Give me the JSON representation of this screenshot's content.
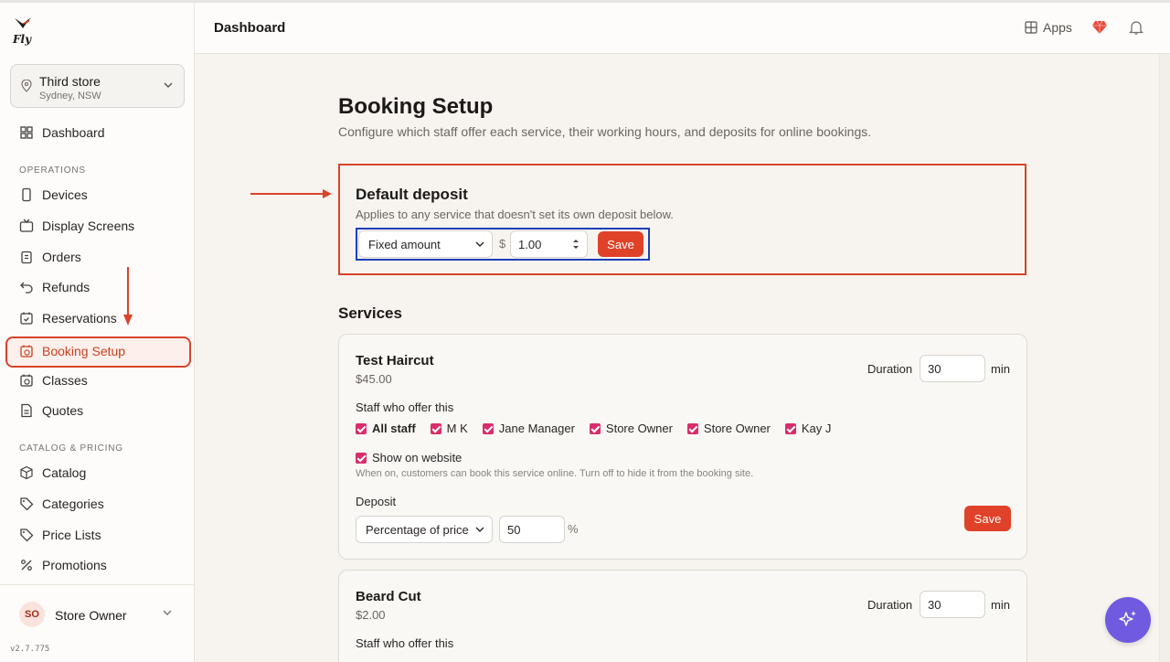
{
  "app": {
    "logo_text": "Fly",
    "version": "v2.7.775"
  },
  "store": {
    "name": "Third store",
    "location": "Sydney, NSW"
  },
  "sidebar": {
    "dashboard": "Dashboard",
    "section_operations": "OPERATIONS",
    "operations": [
      "Devices",
      "Display Screens",
      "Orders",
      "Refunds",
      "Reservations",
      "Booking Setup",
      "Classes",
      "Quotes"
    ],
    "section_catalog": "CATALOG & PRICING",
    "catalog": [
      "Catalog",
      "Categories",
      "Price Lists",
      "Promotions"
    ],
    "active": "Booking Setup"
  },
  "user": {
    "initials": "SO",
    "name": "Store Owner"
  },
  "header": {
    "title": "Dashboard",
    "apps_label": "Apps"
  },
  "page": {
    "title": "Booking Setup",
    "subtitle": "Configure which staff offer each service, their working hours, and deposits for online bookings."
  },
  "default_deposit": {
    "title": "Default deposit",
    "subtitle": "Applies to any service that doesn't set its own deposit below.",
    "type": "Fixed amount",
    "currency": "$",
    "amount": "1.00",
    "save_label": "Save"
  },
  "services_heading": "Services",
  "services": [
    {
      "name": "Test Haircut",
      "price": "$45.00",
      "duration_label": "Duration",
      "duration": "30",
      "duration_unit": "min",
      "staff_label": "Staff who offer this",
      "staff": [
        "All staff",
        "M K",
        "Jane Manager",
        "Store Owner",
        "Store Owner",
        "Kay J"
      ],
      "show_on_website": "Show on website",
      "website_hint": "When on, customers can book this service online. Turn off to hide it from the booking site.",
      "deposit_label": "Deposit",
      "deposit_type": "Percentage of price",
      "deposit_value": "50",
      "deposit_unit": "%",
      "save_label": "Save"
    },
    {
      "name": "Beard Cut",
      "price": "$2.00",
      "duration_label": "Duration",
      "duration": "30",
      "duration_unit": "min",
      "staff_label": "Staff who offer this"
    }
  ],
  "colors": {
    "accent": "#df4228",
    "highlight_red": "#d9432a",
    "highlight_blue": "#1d3fb8",
    "checkbox": "#d92d6b",
    "fab": "#6f5ae0"
  }
}
